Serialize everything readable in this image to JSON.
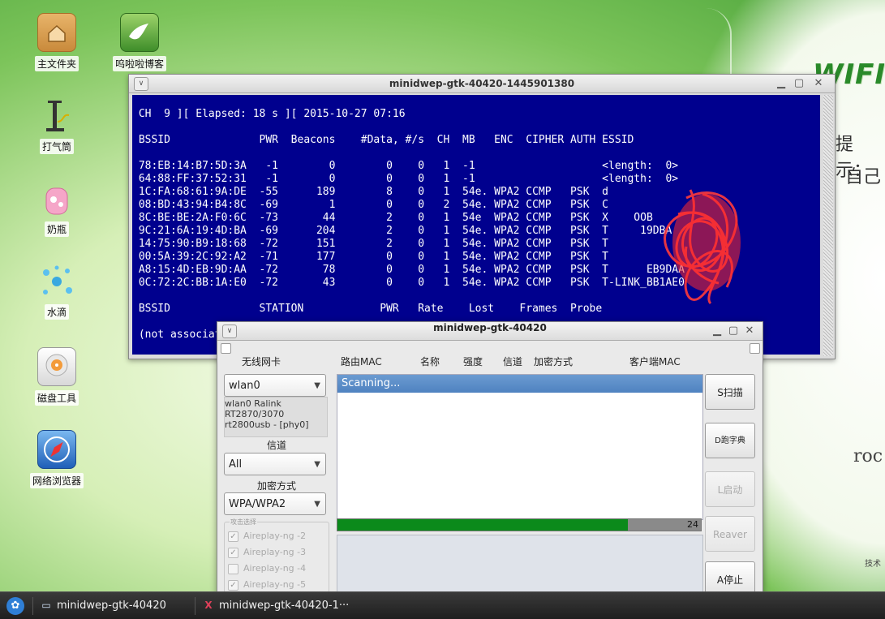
{
  "desktop": {
    "icons": [
      {
        "label": "主文件夹",
        "icon": "home-folder-icon"
      },
      {
        "label": "呜啦啦博客",
        "icon": "dove-icon"
      },
      {
        "label": "打气筒",
        "icon": "pump-icon"
      },
      {
        "label": "奶瓶",
        "icon": "baby-bottle-icon"
      },
      {
        "label": "水滴",
        "icon": "water-splash-icon"
      },
      {
        "label": "磁盘工具",
        "icon": "disk-icon"
      },
      {
        "label": "网络浏览器",
        "icon": "compass-icon"
      }
    ],
    "wallpaper": {
      "wifi": "WIFI",
      "tip1": "提示：",
      "tip2": "自己",
      "rock": "roc",
      "small": "技术"
    }
  },
  "terminal": {
    "title": "minidwep-gtk-40420-1445901380",
    "lines": [
      "",
      " CH  9 ][ Elapsed: 18 s ][ 2015-10-27 07:16",
      "",
      " BSSID              PWR  Beacons    #Data, #/s  CH  MB   ENC  CIPHER AUTH ESSID",
      "",
      " 78:EB:14:B7:5D:3A   -1        0        0    0   1  -1                    <length:  0>",
      " 64:88:FF:37:52:31   -1        0        0    0   1  -1                    <length:  0>",
      " 1C:FA:68:61:9A:DE  -55      189        8    0   1  54e. WPA2 CCMP   PSK  d",
      " 08:BD:43:94:B4:8C  -69        1        0    0   2  54e. WPA2 CCMP   PSK  C",
      " 8C:BE:BE:2A:F0:6C  -73       44        2    0   1  54e  WPA2 CCMP   PSK  X    OOB",
      " 9C:21:6A:19:4D:BA  -69      204        2    0   1  54e. WPA2 CCMP   PSK  T     19DBA",
      " 14:75:90:B9:18:68  -72      151        2    0   1  54e. WPA2 CCMP   PSK  T",
      " 00:5A:39:2C:92:A2  -71      177        0    0   1  54e. WPA2 CCMP   PSK  T",
      " A8:15:4D:EB:9D:AA  -72       78        0    0   1  54e. WPA2 CCMP   PSK  T      EB9DAA",
      " 0C:72:2C:BB:1A:E0  -72       43        0    0   1  54e. WPA2 CCMP   PSK  T-LINK_BB1AE0",
      "",
      " BSSID              STATION            PWR   Rate    Lost    Frames  Probe",
      "",
      " (not associated)"
    ]
  },
  "minidwep": {
    "title": "minidwep-gtk-40420",
    "headers": {
      "adapter": "无线网卡",
      "router_mac": "路由MAC",
      "name": "名称",
      "strength": "强度",
      "channel": "信道",
      "encryption": "加密方式",
      "client_mac": "客户端MAC"
    },
    "adapter_select": "wlan0",
    "adapter_info": [
      "wlan0 Ralink",
      "RT2870/3070",
      "rt2800usb - [phy0]"
    ],
    "channel_label": "信道",
    "channel_select": "All",
    "enc_label": "加密方式",
    "enc_select": "WPA/WPA2",
    "attack_group": "攻击选择",
    "attacks": [
      {
        "label": "Aireplay-ng -2",
        "checked": true
      },
      {
        "label": "Aireplay-ng -3",
        "checked": true
      },
      {
        "label": "Aireplay-ng -4",
        "checked": false
      },
      {
        "label": "Aireplay-ng -5",
        "checked": true
      }
    ],
    "list_status": "Scanning...",
    "progress_value": 24,
    "progress_fraction": 0.8,
    "buttons": {
      "scan": "S扫描",
      "dict": "D跑字典",
      "launch": "L启动",
      "reaver": "Reaver",
      "stop": "A停止"
    }
  },
  "taskbar": {
    "items": [
      {
        "label": "minidwep-gtk-40420",
        "icon": "window-icon"
      },
      {
        "label": "minidwep-gtk-40420-1···",
        "icon": "terminal-x-icon"
      }
    ]
  }
}
